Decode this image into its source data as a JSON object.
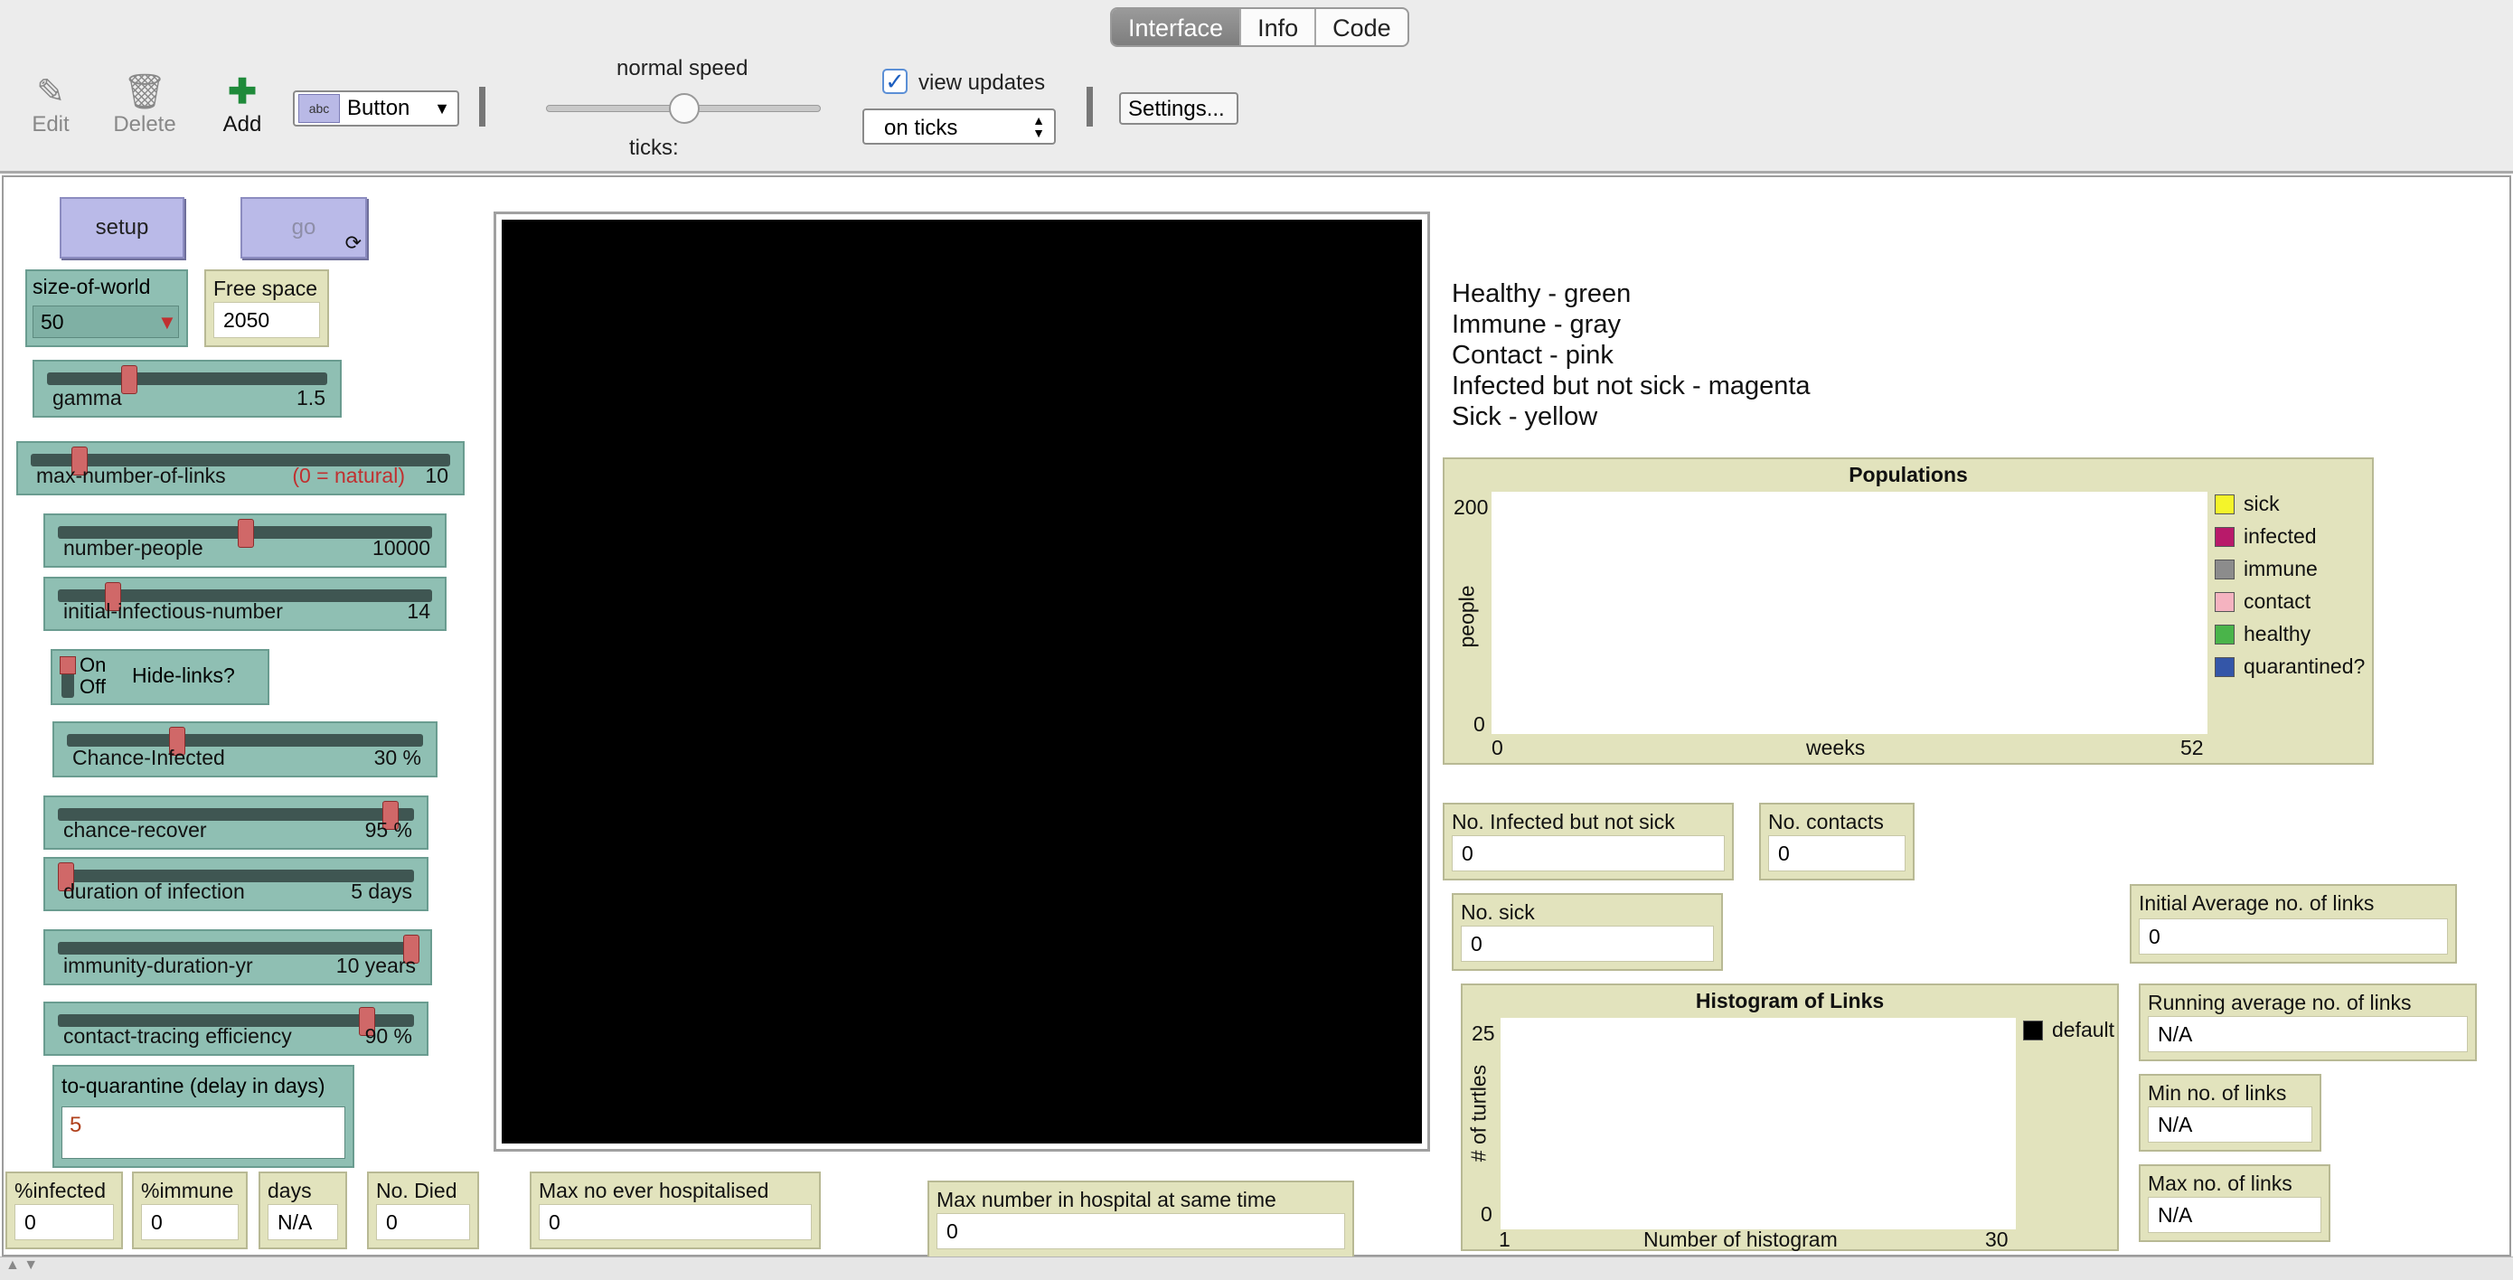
{
  "tabs": [
    {
      "label": "Interface",
      "active": true
    },
    {
      "label": "Info",
      "active": false
    },
    {
      "label": "Code",
      "active": false
    }
  ],
  "toolbar": {
    "edit_label": "Edit",
    "delete_label": "Delete",
    "add_label": "Add",
    "widget_type": "Button",
    "speed_label": "normal speed",
    "speed_level": 0.5,
    "ticks_label": "ticks:",
    "view_updates_label": "view updates",
    "view_updates_checked": true,
    "update_mode": "on ticks",
    "settings_label": "Settings..."
  },
  "buttons": {
    "setup": "setup",
    "go": "go"
  },
  "chooser": {
    "label": "size-of-world",
    "value": "50"
  },
  "free_space": {
    "label": "Free space",
    "value": "2050"
  },
  "sliders": [
    {
      "id": "gamma",
      "label": "gamma",
      "note": "",
      "value": "1.5",
      "position": 0.28
    },
    {
      "id": "max-number-of-links",
      "label": "max-number-of-links",
      "note": "(0 = natural)",
      "value": "10",
      "position": 0.1
    },
    {
      "id": "number-people",
      "label": "number-people",
      "value": "10000",
      "position": 0.5
    },
    {
      "id": "initial-infectious-number",
      "label": "initial-infectious-number",
      "value": "14",
      "position": 0.13
    },
    {
      "id": "chance-infected",
      "label": "Chance-Infected",
      "value": "30 %",
      "position": 0.3
    },
    {
      "id": "chance-recover",
      "label": "chance-recover",
      "value": "95 %",
      "position": 0.95
    },
    {
      "id": "duration-of-infection",
      "label": "duration  of infection",
      "value": "5 days",
      "position": 0.0
    },
    {
      "id": "immunity-duration-yr",
      "label": "immunity-duration-yr",
      "value": "10 years",
      "position": 1.0
    },
    {
      "id": "contact-tracing-efficiency",
      "label": "contact-tracing  efficiency",
      "value": "90 %",
      "position": 0.88
    }
  ],
  "switch": {
    "on": "On",
    "off": "Off",
    "label": "Hide-links?"
  },
  "quarantine_input": {
    "label": "to-quarantine  (delay in days)",
    "value": "5"
  },
  "notes": [
    "Healthy - green",
    "Immune - gray",
    "Contact - pink",
    "Infected but not sick - magenta",
    "Sick - yellow"
  ],
  "populations_plot": {
    "title": "Populations",
    "ylabel": "people",
    "xlabel": "weeks",
    "ymax": "200",
    "ymin": "0",
    "xmin": "0",
    "xmax": "52",
    "legend": [
      {
        "name": "sick",
        "color": "#f4f42a"
      },
      {
        "name": "infected",
        "color": "#b81a6a"
      },
      {
        "name": "immune",
        "color": "#8c8c8c"
      },
      {
        "name": "contact",
        "color": "#f5b3c0"
      },
      {
        "name": "healthy",
        "color": "#4ab44a"
      },
      {
        "name": "quarantined?",
        "color": "#3456a8"
      }
    ]
  },
  "histogram_plot": {
    "title": "Histogram of Links",
    "ylabel": "# of turtles",
    "xlabel": "Number of histogram",
    "ymax": "25",
    "ymin": "0",
    "xmin": "1",
    "xmax": "30",
    "legend": [
      {
        "name": "default",
        "color": "#000000"
      }
    ]
  },
  "monitors": {
    "infected_not_sick": {
      "label": "No. Infected but not sick",
      "value": "0"
    },
    "contacts": {
      "label": "No. contacts",
      "value": "0"
    },
    "sick": {
      "label": "No. sick",
      "value": "0"
    },
    "initial_avg_links": {
      "label": "Initial Average no. of links",
      "value": "0"
    },
    "running_avg_links": {
      "label": "Running average no. of links",
      "value": "N/A"
    },
    "min_links": {
      "label": "Min no. of links",
      "value": "N/A"
    },
    "max_links": {
      "label": "Max no. of links",
      "value": "N/A"
    },
    "pct_infected": {
      "label": "%infected",
      "value": "0"
    },
    "pct_immune": {
      "label": "%immune",
      "value": "0"
    },
    "days": {
      "label": "days",
      "value": "N/A"
    },
    "died": {
      "label": "No. Died",
      "value": "0"
    },
    "max_hospitalised": {
      "label": "Max no ever hospitalised",
      "value": "0"
    },
    "max_hospital_same_time": {
      "label": "Max number in hospital at same time",
      "value": "0"
    }
  }
}
